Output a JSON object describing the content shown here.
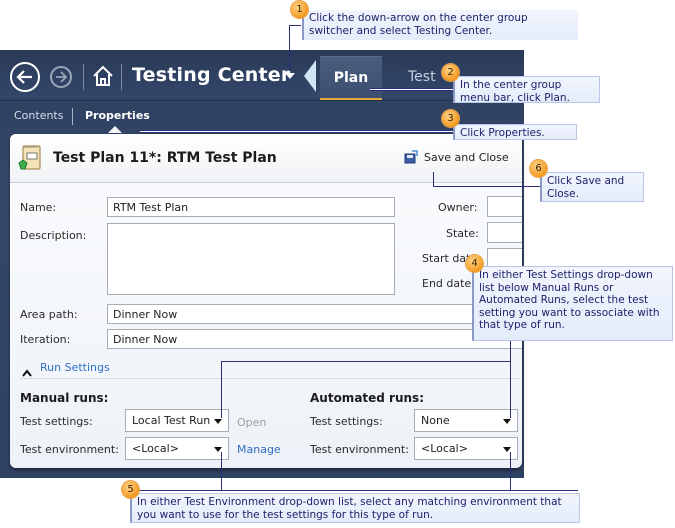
{
  "app": {
    "title": "Testing Center",
    "center_group_tabs": [
      {
        "label": "Plan",
        "selected": true
      },
      {
        "label": "Test",
        "selected": false
      }
    ],
    "sub_nav": [
      {
        "label": "Contents",
        "selected": false
      },
      {
        "label": "Properties",
        "selected": true
      }
    ],
    "icons": {
      "back": "back-arrow-circle-icon",
      "forward": "forward-arrow-circle-icon",
      "home": "home-icon",
      "switcher": "caret-down-icon",
      "collapse_nav": "triangle-left-icon"
    }
  },
  "panel": {
    "title": "Test Plan 11*: RTM Test Plan",
    "save_close_label": "Save and Close",
    "fields": {
      "name_label": "Name:",
      "name_value": "RTM Test Plan",
      "description_label": "Description:",
      "description_value": "",
      "owner_label": "Owner:",
      "state_label": "State:",
      "start_date_label": "Start date:",
      "end_date_label": "End date:",
      "area_path_label": "Area path:",
      "area_path_value": "Dinner Now",
      "iteration_label": "Iteration:",
      "iteration_value": "Dinner Now"
    },
    "run_settings": {
      "section_label": "Run Settings",
      "expanded": true,
      "manual": {
        "heading": "Manual runs:",
        "test_settings_label": "Test settings:",
        "test_settings_value": "Local Test Run",
        "open_label": "Open",
        "test_environment_label": "Test environment:",
        "test_environment_value": "<Local>",
        "manage_label": "Manage"
      },
      "automated": {
        "heading": "Automated runs:",
        "test_settings_label": "Test settings:",
        "test_settings_value": "None",
        "test_environment_label": "Test environment:",
        "test_environment_value": "<Local>"
      }
    }
  },
  "callouts": [
    {
      "number": "1",
      "text": "Click the down-arrow on the center group switcher and select Testing Center."
    },
    {
      "number": "2",
      "text": "In the center group menu bar, click Plan."
    },
    {
      "number": "3",
      "text": "Click Properties."
    },
    {
      "number": "4",
      "text": "In either Test Settings drop-down list below Manual Runs or Automated Runs, select the test setting you want to associate with that type of run."
    },
    {
      "number": "5",
      "text": "In either Test Environment drop-down list, select any matching environment that you want to use for the test settings for this type of run."
    },
    {
      "number": "6",
      "text": "Click Save and Close."
    }
  ],
  "colors": {
    "app_background": "#2f4264",
    "selected_tab_underline": "#e2a93a",
    "link": "#2f6fc4",
    "callout_text": "#1d1d6a",
    "badge": "#f49a1f"
  }
}
